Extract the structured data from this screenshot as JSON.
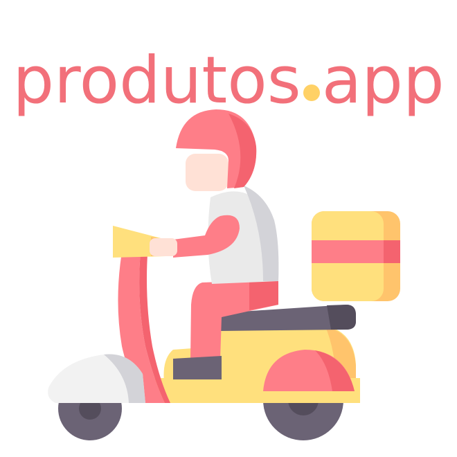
{
  "logo": {
    "name_part": "produtos",
    "tld_part": "app",
    "text_color": "#f2707a",
    "dot_color": "#ffd166"
  },
  "illustration": {
    "subject": "delivery-scooter-rider",
    "colors": {
      "pink": "#fe7e88",
      "pink_dark": "#f4636f",
      "yellow": "#ffe07d",
      "yellow_dark": "#ffc46c",
      "grey": "#6b6375",
      "grey_dark": "#544d5c",
      "skin": "#ffe1d6",
      "shirt": "#eaeaea",
      "shirt_shadow": "#d3d3d8",
      "white": "#f2f2f2"
    }
  }
}
